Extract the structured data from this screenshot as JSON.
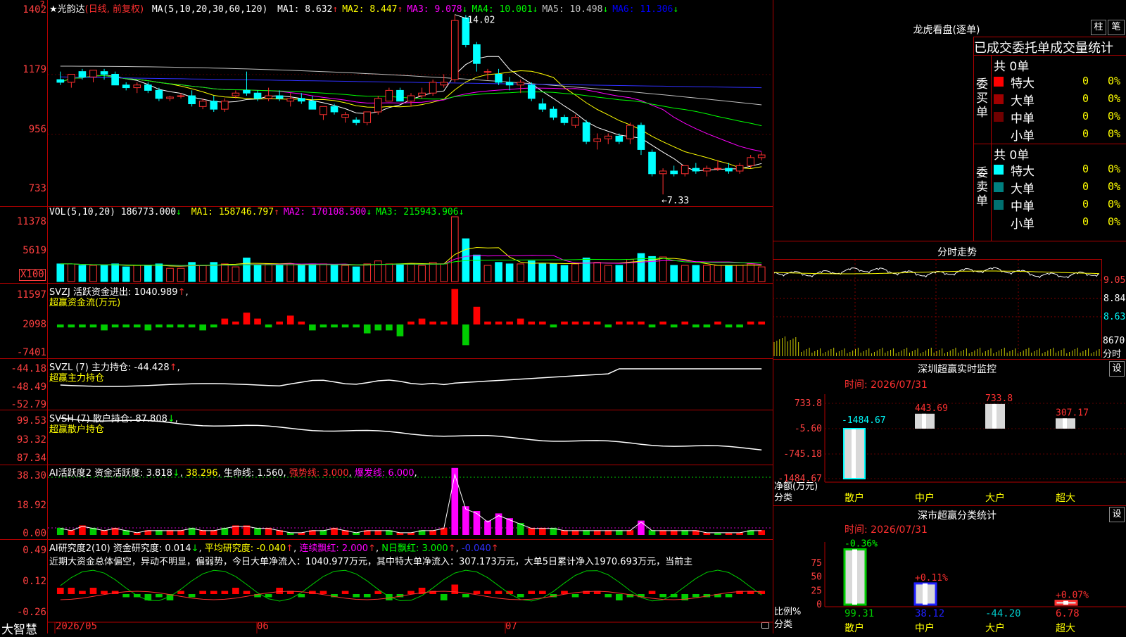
{
  "brand": "大智慧",
  "stock": {
    "name": "★光韵达",
    "period": "(日线, 前复权)"
  },
  "kline": {
    "header_label": "MA(5,10,20,30,60,120)",
    "ma": [
      {
        "name": "MA1:",
        "value": "8.632",
        "arrow": "↑",
        "color": "#ffffff"
      },
      {
        "name": "MA2:",
        "value": "8.447",
        "arrow": "↑",
        "color": "#ffff00"
      },
      {
        "name": "MA3:",
        "value": "9.078",
        "arrow": "↓",
        "color": "#ff00ff"
      },
      {
        "name": "MA4:",
        "value": "10.001",
        "arrow": "↓",
        "color": "#00ff00"
      },
      {
        "name": "MA5:",
        "value": "10.498",
        "arrow": "↓",
        "color": "#c0c0c0"
      },
      {
        "name": "MA6:",
        "value": "11.306",
        "arrow": "↓",
        "color": "#0000ff"
      }
    ],
    "ylabels": [
      "1402",
      "1179",
      "956",
      "733"
    ],
    "high_marker": "14.02",
    "low_marker": "7.33",
    "candles": [
      [
        11.6,
        11.9,
        11.4,
        11.5
      ],
      [
        11.5,
        11.8,
        11.3,
        11.8
      ],
      [
        11.9,
        12.0,
        11.6,
        11.7
      ],
      [
        11.7,
        11.9,
        11.5,
        11.95
      ],
      [
        11.9,
        12.0,
        11.6,
        11.8
      ],
      [
        11.8,
        11.9,
        11.4,
        11.4
      ],
      [
        11.4,
        11.5,
        11.2,
        11.3
      ],
      [
        11.3,
        11.5,
        11.1,
        11.4
      ],
      [
        11.4,
        11.5,
        11.1,
        11.2
      ],
      [
        11.2,
        11.3,
        10.8,
        10.9
      ],
      [
        10.9,
        11.0,
        10.8,
        10.95
      ],
      [
        11.0,
        11.1,
        10.9,
        11.0
      ],
      [
        11.0,
        11.2,
        10.6,
        10.7
      ],
      [
        10.6,
        10.9,
        10.5,
        10.8
      ],
      [
        10.8,
        11.0,
        10.4,
        10.5
      ],
      [
        10.5,
        10.9,
        10.4,
        10.8
      ],
      [
        11.0,
        11.2,
        10.9,
        11.1
      ],
      [
        11.2,
        11.9,
        11.0,
        11.1
      ],
      [
        11.1,
        11.2,
        10.8,
        10.9
      ],
      [
        10.9,
        11.3,
        10.8,
        11.0
      ],
      [
        11.0,
        11.2,
        10.8,
        10.9
      ],
      [
        10.8,
        11.1,
        10.6,
        10.9
      ],
      [
        10.9,
        11.1,
        10.7,
        10.8
      ],
      [
        10.8,
        11.0,
        10.5,
        10.5
      ],
      [
        10.3,
        10.6,
        10.1,
        10.6
      ],
      [
        10.6,
        10.7,
        10.3,
        10.4
      ],
      [
        10.2,
        10.4,
        10.0,
        10.3
      ],
      [
        10.1,
        10.2,
        9.9,
        10.0
      ],
      [
        10.0,
        10.4,
        9.9,
        10.4
      ],
      [
        10.4,
        11.0,
        10.3,
        10.9
      ],
      [
        10.8,
        11.3,
        10.8,
        11.2
      ],
      [
        11.2,
        11.3,
        10.8,
        10.8
      ],
      [
        10.8,
        11.1,
        10.6,
        11.0
      ],
      [
        11.0,
        11.3,
        10.9,
        11.1
      ],
      [
        11.1,
        11.6,
        11.0,
        11.5
      ],
      [
        11.4,
        11.8,
        11.3,
        11.5
      ],
      [
        11.6,
        14.02,
        11.5,
        13.8
      ],
      [
        13.9,
        14.0,
        12.8,
        12.9
      ],
      [
        12.9,
        13.0,
        11.9,
        12.2
      ],
      [
        11.9,
        12.0,
        11.6,
        11.9
      ],
      [
        11.8,
        12.0,
        11.4,
        11.5
      ],
      [
        11.5,
        11.7,
        11.2,
        11.4
      ],
      [
        11.4,
        11.6,
        11.1,
        11.5
      ],
      [
        11.4,
        11.5,
        10.8,
        10.9
      ],
      [
        10.7,
        10.9,
        10.4,
        10.5
      ],
      [
        10.5,
        10.6,
        10.1,
        10.2
      ],
      [
        10.2,
        10.3,
        9.9,
        10.0
      ],
      [
        9.9,
        10.3,
        9.8,
        10.2
      ],
      [
        10.0,
        10.1,
        9.2,
        9.3
      ],
      [
        9.3,
        9.6,
        9.0,
        9.4
      ],
      [
        9.4,
        9.6,
        9.2,
        9.5
      ],
      [
        9.5,
        9.6,
        9.2,
        9.3
      ],
      [
        9.4,
        10.0,
        9.2,
        9.9
      ],
      [
        9.9,
        10.0,
        8.8,
        9.0
      ],
      [
        8.9,
        9.0,
        8.0,
        8.1
      ],
      [
        8.1,
        8.3,
        7.33,
        8.2
      ],
      [
        8.2,
        8.4,
        8.0,
        8.1
      ],
      [
        8.1,
        8.4,
        8.0,
        8.4
      ],
      [
        8.3,
        8.5,
        8.1,
        8.2
      ],
      [
        8.2,
        8.4,
        8.0,
        8.3
      ],
      [
        8.3,
        8.6,
        8.2,
        8.3
      ],
      [
        8.3,
        8.5,
        8.1,
        8.2
      ],
      [
        8.2,
        8.5,
        8.1,
        8.4
      ],
      [
        8.4,
        8.8,
        8.3,
        8.7
      ],
      [
        8.7,
        8.9,
        8.6,
        8.8
      ]
    ]
  },
  "vol": {
    "header_label": "VOL(5,10,20)",
    "value": "186773.000",
    "arrow": "↓",
    "ma": [
      {
        "name": "MA1:",
        "value": "158746.797",
        "arrow": "↑",
        "color": "#ffff00"
      },
      {
        "name": "MA2:",
        "value": "170108.500",
        "arrow": "↓",
        "color": "#ff00ff"
      },
      {
        "name": "MA3:",
        "value": "215943.906",
        "arrow": "↓",
        "color": "#00ff00"
      }
    ],
    "ylabels": [
      "11378",
      "5619"
    ],
    "unit": "X100"
  },
  "svzj": {
    "header": "SVZJ  活跃资金进出:",
    "value": "1040.989",
    "arrow": "↑",
    "sub": "超赢资金流(万元)",
    "ylabels": [
      "11597",
      "2098",
      "-7401"
    ]
  },
  "svzl": {
    "header": "SVZL (7) 主力持仓:",
    "value": "-44.428",
    "arrow": "↑",
    "sub": "超赢主力持仓",
    "ylabels": [
      "-44.18",
      "-48.49",
      "-52.79"
    ]
  },
  "svsh": {
    "header": "SVSH (7) 散户持仓:",
    "value": "87.808",
    "arrow": "↓",
    "sub": "超赢散户持仓",
    "ylabels": [
      "99.53",
      "93.32",
      "87.34"
    ]
  },
  "ai_active": {
    "header": "AI活跃度2 资金活跃度:",
    "value": "3.818",
    "arrow": "↓",
    "v2": "38.296",
    "life": "生命线: 1.560",
    "strong": "强势线: 3.000",
    "burst": "爆发线: 6.000",
    "ylabels": [
      "38.30",
      "18.92",
      "0.00"
    ]
  },
  "ai_research": {
    "header": "AI研究度2(10) 资金研究度:",
    "value": "0.014",
    "arrow": "↓",
    "avg": "平均研究度: -0.040",
    "avg_arrow": "↑",
    "lianxu": "连续飘红: 2.000",
    "lianxu_arrow": "↑",
    "nday": "N日飘红: 3.000",
    "nday_arrow": "↑",
    "last": "-0.040",
    "last_arrow": "↑",
    "comment": "近期大资金总体偏空，异动不明显，偏弱势，今日大单净流入：1040.977万元，其中特大单净流入：307.173万元，大单5日累计净入1970.693万元，当前主",
    "ylabels": [
      "0.49",
      "0.12",
      "-0.26"
    ]
  },
  "dates": [
    "2026/05",
    "06",
    "07"
  ],
  "right": {
    "longhu_title": "龙虎看盘(逐单)",
    "btn_zhu": "柱",
    "btn_bi": "笔",
    "stat_title": "已成交委托单成交量统计",
    "buy_label": "委买单",
    "sell_label": "委卖单",
    "buy_total": "共 0单",
    "sell_total": "共 0单",
    "buy_rows": [
      {
        "name": "特大",
        "count": "0",
        "pct": "0%",
        "color": "#ff0000"
      },
      {
        "name": "大单",
        "count": "0",
        "pct": "0%",
        "color": "#a00000"
      },
      {
        "name": "中单",
        "count": "0",
        "pct": "0%",
        "color": "#700000"
      },
      {
        "name": "小单",
        "count": "0",
        "pct": "0%",
        "color": "#000000"
      }
    ],
    "sell_rows": [
      {
        "name": "特大",
        "count": "0",
        "pct": "0%",
        "color": "#00ffff"
      },
      {
        "name": "大单",
        "count": "0",
        "pct": "0%",
        "color": "#008080"
      },
      {
        "name": "中单",
        "count": "0",
        "pct": "0%",
        "color": "#007070"
      },
      {
        "name": "小单",
        "count": "0",
        "pct": "0%",
        "color": "#000000"
      }
    ],
    "intraday_title": "分时走势",
    "intraday_labels": [
      "9.05",
      "8.84",
      "8.63",
      "8670",
      "分时"
    ],
    "monitor_title": "深圳超赢实时监控",
    "monitor_btn": "设",
    "monitor_time": "时间: 2026/07/31",
    "monitor_y": [
      "733.8",
      "-5.60",
      "-745.18",
      "-1484.67"
    ],
    "monitor_ylabel": "净额(万元)",
    "monitor_xlabel": "分类",
    "monitor_values": [
      -1484.67,
      443.69,
      733.8,
      307.17
    ],
    "monitor_value_labels": [
      "-1484.67",
      "443.69",
      "733.8",
      "307.17"
    ],
    "monitor_cats": [
      "散户",
      "中户",
      "大户",
      "超大"
    ],
    "class_title": "深市超赢分类统计",
    "class_btn": "设",
    "class_time": "时间: 2026/07/31",
    "class_y": [
      "75",
      "50",
      "25",
      "0"
    ],
    "class_ylabel": "比例%",
    "class_xlabel": "分类",
    "class_pct_labels": [
      "-0.36%",
      "+0.11%",
      "",
      "+0.07%"
    ],
    "class_values": [
      99.31,
      38.12,
      -44.2,
      6.78
    ],
    "class_value_labels": [
      "99.31",
      "38.12",
      "-44.20",
      "6.78"
    ],
    "class_cats": [
      "散户",
      "中户",
      "大户",
      "超大"
    ]
  },
  "colors": {
    "up": "#ff3030",
    "down": "#00ffff",
    "border": "#b00000"
  }
}
